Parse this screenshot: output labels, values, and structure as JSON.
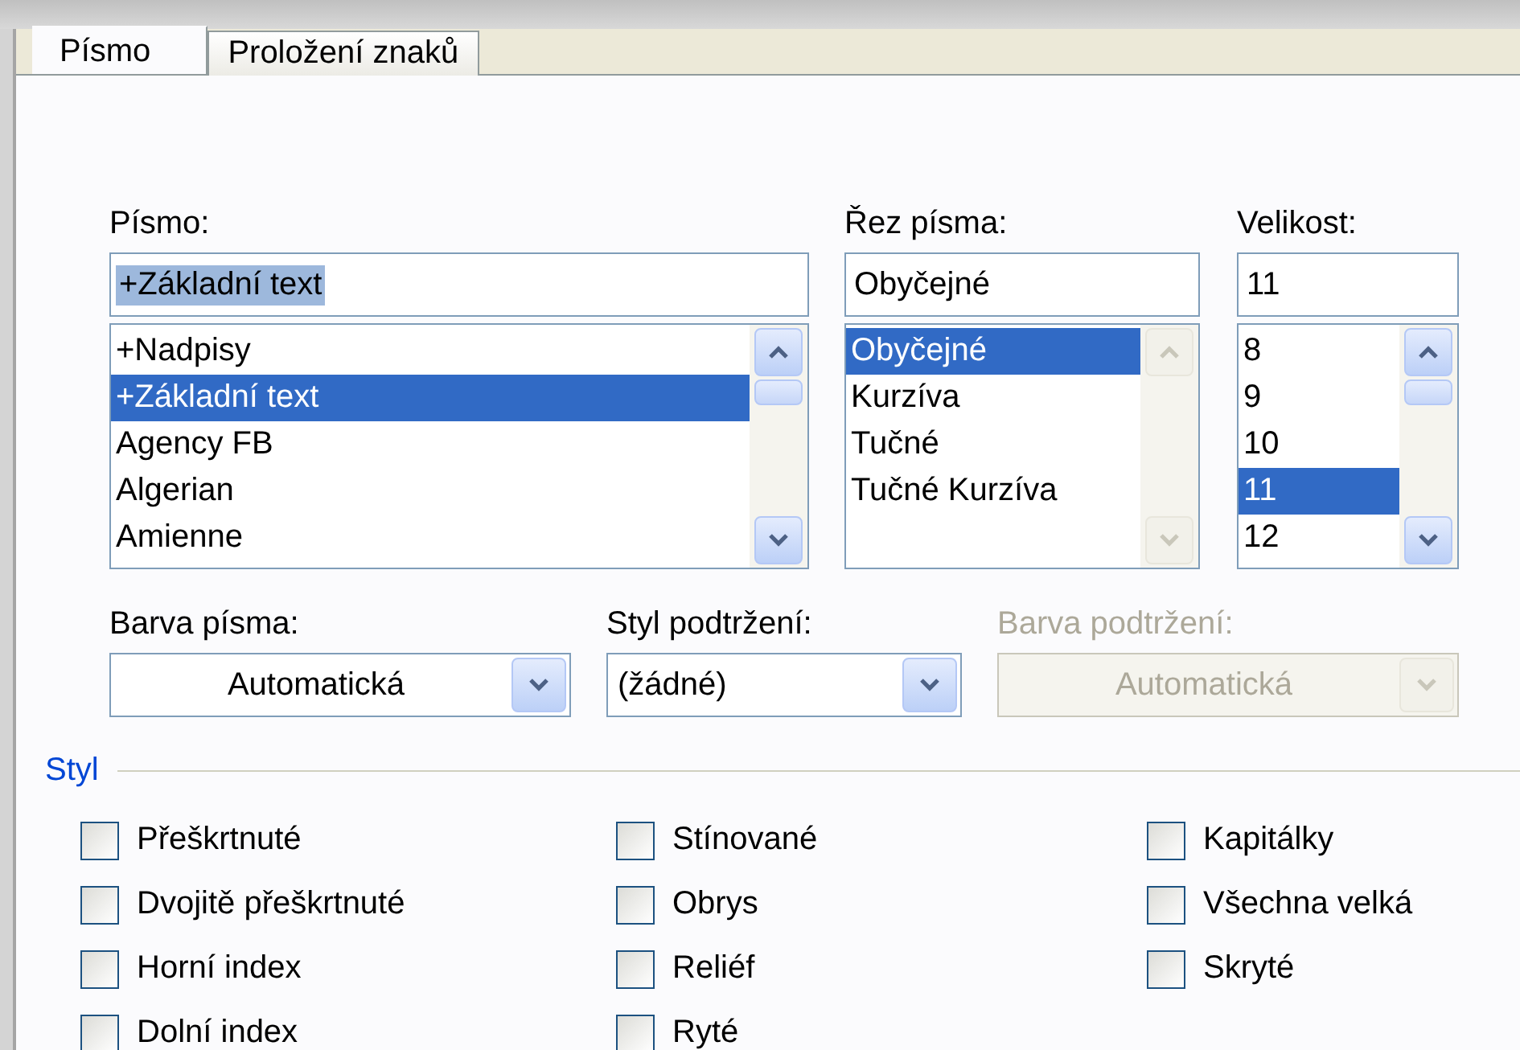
{
  "tabs": [
    {
      "label": "Písmo",
      "selected": true
    },
    {
      "label": "Proložení znaků",
      "selected": false
    }
  ],
  "lists": [
    {
      "label": "Písmo:",
      "value": "+Základní text",
      "value_selected": true,
      "scrollbar_disabled": false,
      "items": [
        {
          "label": "+Nadpisy",
          "selected": false
        },
        {
          "label": "+Základní text",
          "selected": true
        },
        {
          "label": "Agency FB",
          "selected": false
        },
        {
          "label": "Algerian",
          "selected": false
        },
        {
          "label": "Amienne",
          "selected": false
        }
      ]
    },
    {
      "label": "Řez písma:",
      "value": "Obyčejné",
      "scrollbar_disabled": true,
      "items": [
        {
          "label": "Obyčejné",
          "selected": true
        },
        {
          "label": "Kurzíva",
          "selected": false
        },
        {
          "label": "Tučné",
          "selected": false
        },
        {
          "label": "Tučné Kurzíva",
          "selected": false
        }
      ]
    },
    {
      "label": "Velikost:",
      "value": "11",
      "scrollbar_disabled": false,
      "items": [
        {
          "label": "8",
          "selected": false
        },
        {
          "label": "9",
          "selected": false
        },
        {
          "label": "10",
          "selected": false
        },
        {
          "label": "11",
          "selected": true
        },
        {
          "label": "12",
          "selected": false
        }
      ]
    }
  ],
  "dropdowns": [
    {
      "label": "Barva písma:",
      "value": "Automatická",
      "kind": "color",
      "disabled": false
    },
    {
      "label": "Styl podtržení:",
      "value": "(žádné)",
      "kind": "style",
      "disabled": false
    },
    {
      "label": "Barva podtržení:",
      "value": "Automatická",
      "kind": "color",
      "disabled": true
    }
  ],
  "effects": {
    "title": "Styl",
    "columns": [
      [
        {
          "label": "Přeškrtnuté",
          "checked": false
        },
        {
          "label": "Dvojitě přeškrtnuté",
          "checked": false
        },
        {
          "label": "Horní index",
          "checked": false
        },
        {
          "label": "Dolní index",
          "checked": false
        }
      ],
      [
        {
          "label": "Stínované",
          "checked": false
        },
        {
          "label": "Obrys",
          "checked": false
        },
        {
          "label": "Reliéf",
          "checked": false
        },
        {
          "label": "Ryté",
          "checked": false
        }
      ],
      [
        {
          "label": "Kapitálky",
          "checked": false
        },
        {
          "label": "Všechna velká",
          "checked": false
        },
        {
          "label": "Skryté",
          "checked": false
        }
      ]
    ]
  }
}
